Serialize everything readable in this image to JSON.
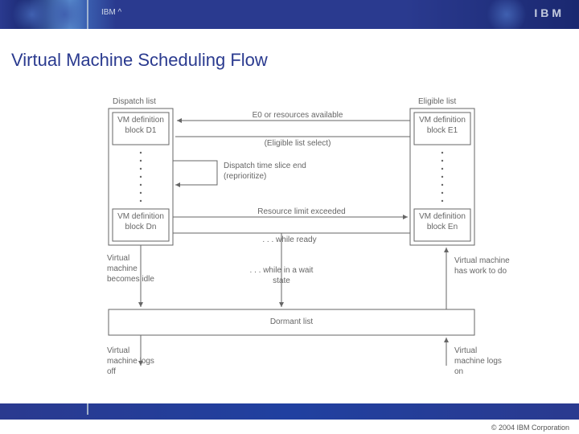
{
  "header": {
    "brand_label": "IBM ^",
    "logo_text": "IBM"
  },
  "title": "Virtual Machine Scheduling Flow",
  "diagram": {
    "dispatch_list_title": "Dispatch list",
    "dispatch_first": "VM definition block D1",
    "dispatch_last": "VM definition block Dn",
    "eligible_list_title": "Eligible list",
    "eligible_first": "VM definition block E1",
    "eligible_last": "VM definition block En",
    "e0_label": "E0 or resources available",
    "el_select": "(Eligible list select)",
    "timeslice": "Dispatch time slice end (reprioritize)",
    "res_limit": "Resource limit exceeded",
    "while_ready": ". . . while ready",
    "becomes_idle": "Virtual machine becomes idle",
    "wait_state": ". . . while in a wait state",
    "has_work": "Virtual machine has work to do",
    "dormant": "Dormant list",
    "logs_off": "Virtual machine logs off",
    "logs_on": "Virtual machine logs on"
  },
  "footer": {
    "copyright": "© 2004 IBM Corporation"
  }
}
